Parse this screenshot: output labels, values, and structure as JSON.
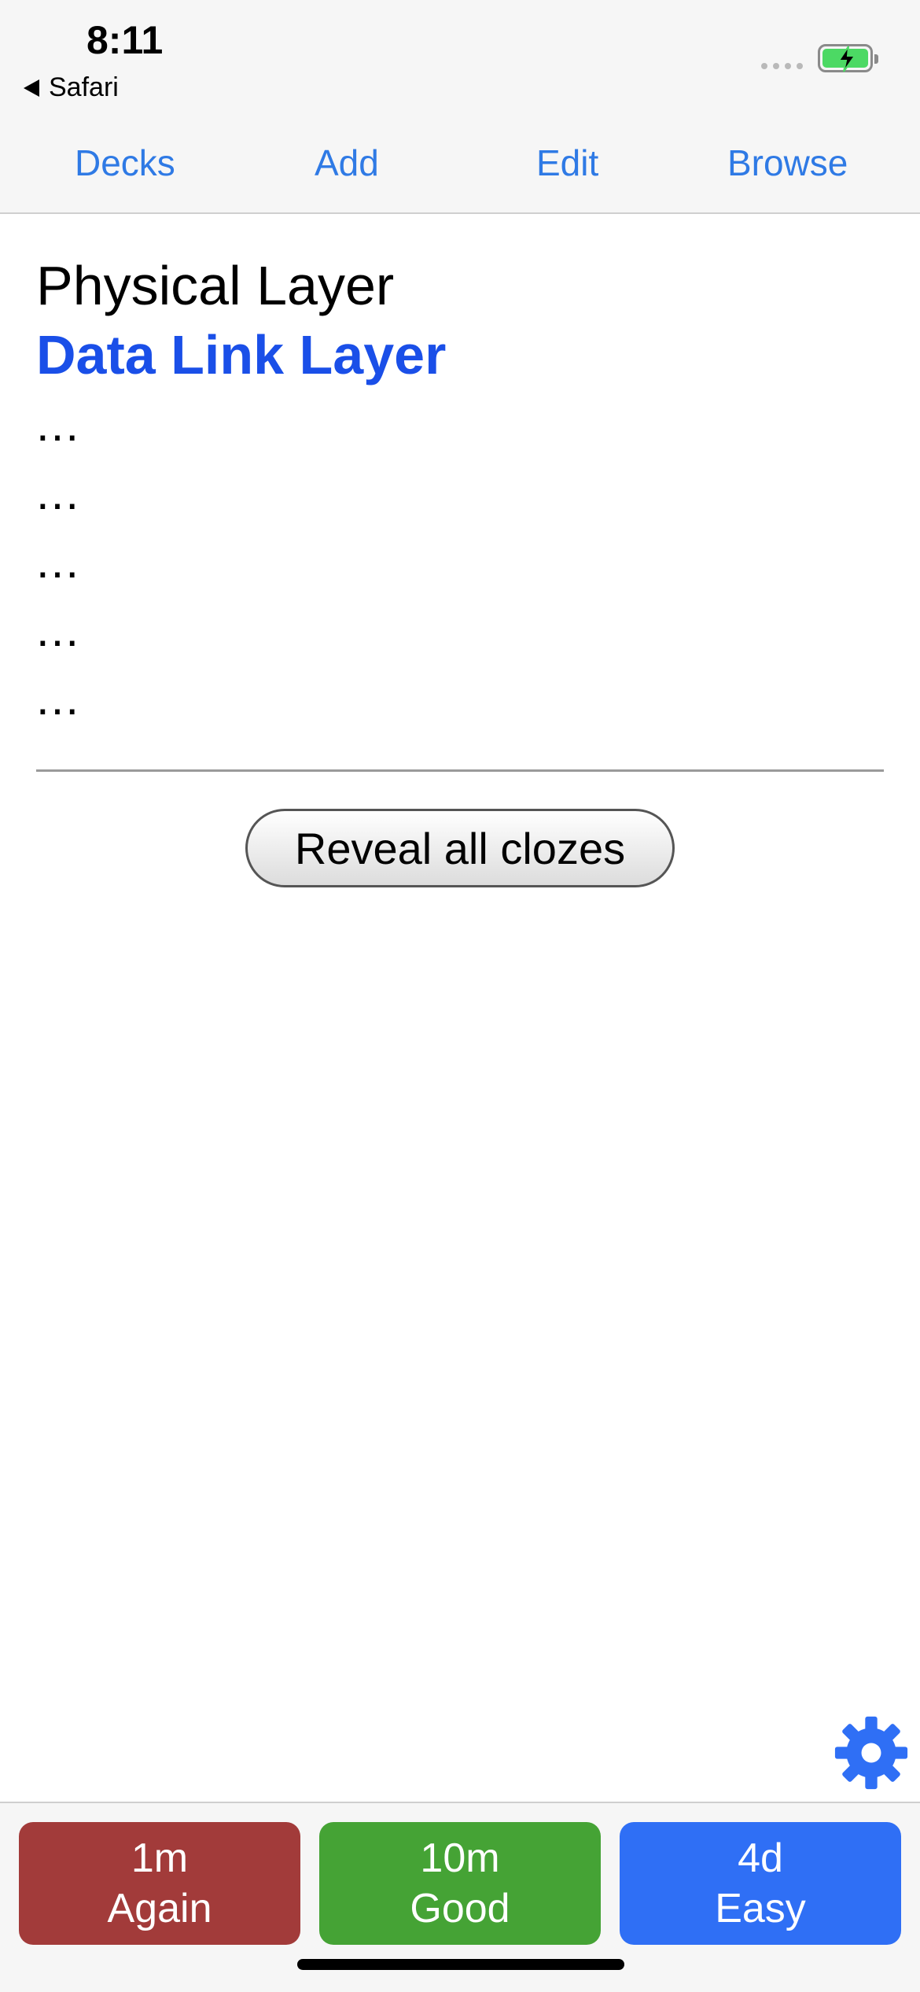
{
  "status_bar": {
    "time": "8:11",
    "back_app": "Safari"
  },
  "nav": {
    "decks": "Decks",
    "add": "Add",
    "edit": "Edit",
    "browse": "Browse",
    "accent_color": "#2f7ae5"
  },
  "card": {
    "line1": "Physical Layer",
    "line2": "Data Link Layer",
    "hidden": [
      "...",
      "...",
      "...",
      "...",
      "..."
    ],
    "cloze_color": "#1a4fe8"
  },
  "reveal_button": "Reveal all clozes",
  "settings_icon": "gear-icon",
  "answers": [
    {
      "interval": "1m",
      "label": "Again",
      "color": "#a23b3a"
    },
    {
      "interval": "10m",
      "label": "Good",
      "color": "#45a335"
    },
    {
      "interval": "4d",
      "label": "Easy",
      "color": "#2f6ff5"
    }
  ]
}
